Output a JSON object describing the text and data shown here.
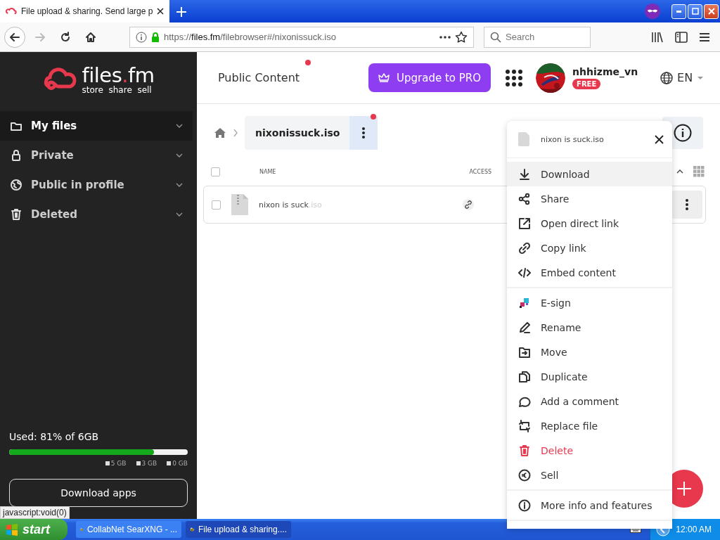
{
  "browser": {
    "tab": {
      "title": "File upload & sharing. Send large p",
      "selected": true
    },
    "back": {
      "disabled": false
    },
    "forward": {
      "disabled": true
    },
    "address": {
      "scheme": "https://",
      "domain": "files.fm",
      "path": "/filebrowser#/nixonissuck.iso"
    },
    "search": {
      "placeholder": "Search"
    }
  },
  "sidebar": {
    "logo": {
      "parts": [
        {
          "text": "files",
          "accent": false
        },
        {
          "text": ".",
          "accent": true
        },
        {
          "text": "fm",
          "accent": false
        }
      ],
      "tagline": "store  share  sell"
    },
    "items": [
      {
        "kind": "folder",
        "label": "My files",
        "selected": true
      },
      {
        "kind": "lock",
        "label": "Private",
        "selected": false
      },
      {
        "kind": "globe",
        "label": "Public in profile",
        "selected": false
      },
      {
        "kind": "trash",
        "label": "Deleted",
        "selected": false
      }
    ],
    "storage": {
      "label": "Used: 81% of 6GB",
      "level": 0.81,
      "legend": [
        "5 GB",
        "3 GB",
        "0 GB"
      ]
    },
    "download_apps": "Download apps"
  },
  "header": {
    "title": "Public Content",
    "notification": true,
    "upgrade": "Upgrade to PRO",
    "user": {
      "name": "nhhizme_vn",
      "plan": "FREE"
    },
    "language": "EN"
  },
  "files": {
    "breadcrumb": {
      "current": "nixonissuck.iso",
      "notification": true
    },
    "select_all": {
      "checked": false
    },
    "columns": [
      "NAME",
      "ACCESS"
    ],
    "rows": [
      {
        "name": "nixon is suck",
        "extension": ".iso",
        "selected": false,
        "shared_link": true
      }
    ]
  },
  "menu": {
    "file": "nixon is suck.iso",
    "sections": [
      [
        {
          "kind": "download",
          "label": "Download",
          "hovered": true,
          "danger": false
        },
        {
          "kind": "share",
          "label": "Share",
          "hovered": false,
          "danger": false
        },
        {
          "kind": "external",
          "label": "Open direct link",
          "hovered": false,
          "danger": false
        },
        {
          "kind": "link",
          "label": "Copy link",
          "hovered": false,
          "danger": false
        },
        {
          "kind": "embed",
          "label": "Embed content",
          "hovered": false,
          "danger": false
        }
      ],
      [
        {
          "kind": "esign",
          "label": "E-sign",
          "hovered": false,
          "danger": false
        },
        {
          "kind": "rename",
          "label": "Rename",
          "hovered": false,
          "danger": false
        },
        {
          "kind": "move",
          "label": "Move",
          "hovered": false,
          "danger": false
        },
        {
          "kind": "duplicate",
          "label": "Duplicate",
          "hovered": false,
          "danger": false
        },
        {
          "kind": "comment",
          "label": "Add a comment",
          "hovered": false,
          "danger": false
        },
        {
          "kind": "replace",
          "label": "Replace file",
          "hovered": false,
          "danger": false
        },
        {
          "kind": "delete",
          "label": "Delete",
          "hovered": false,
          "danger": true
        },
        {
          "kind": "sell",
          "label": "Sell",
          "hovered": false,
          "danger": false
        }
      ],
      [
        {
          "kind": "info",
          "label": "More info and features",
          "hovered": false,
          "danger": false
        }
      ]
    ]
  },
  "status_tooltip": "javascript:void(0)",
  "taskbar": {
    "start": "start",
    "tasks": [
      {
        "label": "CollabNet SearXNG - ...",
        "selected": false
      },
      {
        "label": "File upload & sharing....",
        "selected": true
      }
    ],
    "clock": "12:00 AM"
  }
}
